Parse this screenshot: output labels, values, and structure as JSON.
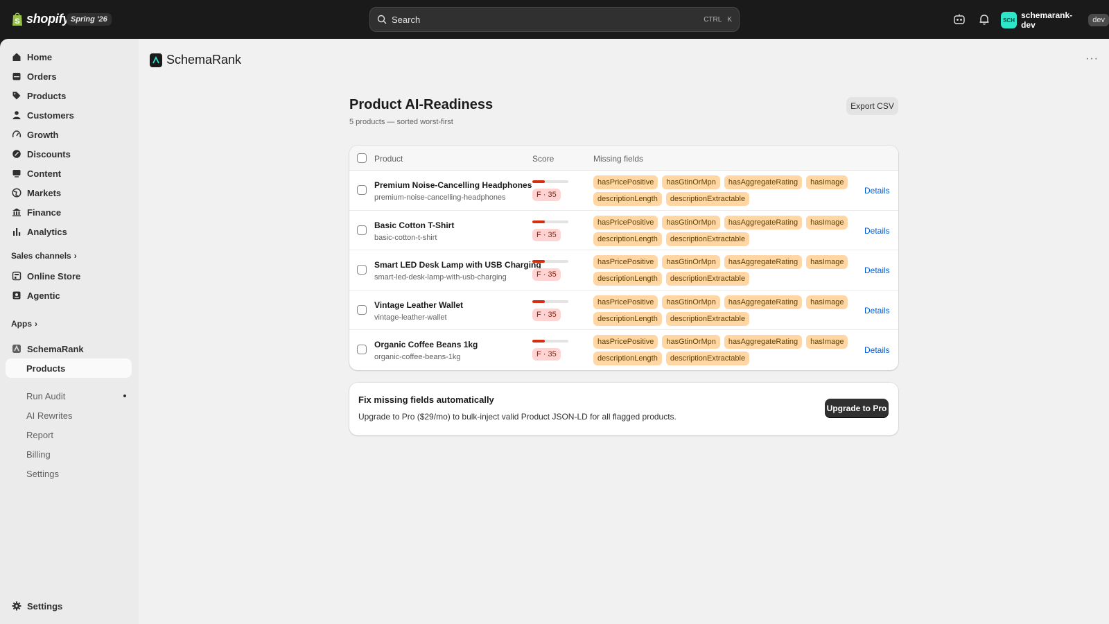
{
  "topbar": {
    "brand": "shopify",
    "edition": "Spring '26",
    "search_placeholder": "Search",
    "shortcut_ctrl": "CTRL",
    "shortcut_key": "K",
    "user_initials": "SCH",
    "user_name": "schemarank-dev",
    "user_badge": "dev"
  },
  "sidebar": {
    "items": [
      {
        "label": "Home",
        "icon": "home-icon"
      },
      {
        "label": "Orders",
        "icon": "inbox-icon"
      },
      {
        "label": "Products",
        "icon": "tag-icon"
      },
      {
        "label": "Customers",
        "icon": "person-icon"
      },
      {
        "label": "Growth",
        "icon": "gauge-icon"
      },
      {
        "label": "Discounts",
        "icon": "discount-icon"
      },
      {
        "label": "Content",
        "icon": "content-icon"
      },
      {
        "label": "Markets",
        "icon": "globe-icon"
      },
      {
        "label": "Finance",
        "icon": "bank-icon"
      },
      {
        "label": "Analytics",
        "icon": "chart-icon"
      }
    ],
    "sales_channels_label": "Sales channels",
    "channels": [
      {
        "label": "Online Store",
        "icon": "store-icon"
      },
      {
        "label": "Agentic",
        "icon": "agent-icon"
      }
    ],
    "apps_label": "Apps",
    "app_name": "SchemaRank",
    "app_subitems": [
      "Products",
      "Run Audit",
      "AI Rewrites",
      "Report",
      "Billing",
      "Settings"
    ],
    "settings_label": "Settings"
  },
  "main": {
    "app_title": "SchemaRank",
    "more_label": "···",
    "page_title": "Product AI-Readiness",
    "page_subtitle": "5 products — sorted worst-first",
    "export_label": "Export CSV",
    "columns": {
      "product": "Product",
      "score": "Score",
      "missing": "Missing fields"
    },
    "rows": [
      {
        "name": "Premium Noise-Cancelling Headphones",
        "handle": "premium-noise-cancelling-headphones",
        "score": 35,
        "grade": "F · 35",
        "missing": [
          "hasPricePositive",
          "hasGtinOrMpn",
          "hasAggregateRating",
          "hasImage",
          "descriptionLength",
          "descriptionExtractable"
        ],
        "action": "Details"
      },
      {
        "name": "Basic Cotton T-Shirt",
        "handle": "basic-cotton-t-shirt",
        "score": 35,
        "grade": "F · 35",
        "missing": [
          "hasPricePositive",
          "hasGtinOrMpn",
          "hasAggregateRating",
          "hasImage",
          "descriptionLength",
          "descriptionExtractable"
        ],
        "action": "Details"
      },
      {
        "name": "Smart LED Desk Lamp with USB Charging",
        "handle": "smart-led-desk-lamp-with-usb-charging",
        "score": 35,
        "grade": "F · 35",
        "missing": [
          "hasPricePositive",
          "hasGtinOrMpn",
          "hasAggregateRating",
          "hasImage",
          "descriptionLength",
          "descriptionExtractable"
        ],
        "action": "Details"
      },
      {
        "name": "Vintage Leather Wallet",
        "handle": "vintage-leather-wallet",
        "score": 35,
        "grade": "F · 35",
        "missing": [
          "hasPricePositive",
          "hasGtinOrMpn",
          "hasAggregateRating",
          "hasImage",
          "descriptionLength",
          "descriptionExtractable"
        ],
        "action": "Details"
      },
      {
        "name": "Organic Coffee Beans 1kg",
        "handle": "organic-coffee-beans-1kg",
        "score": 35,
        "grade": "F · 35",
        "missing": [
          "hasPricePositive",
          "hasGtinOrMpn",
          "hasAggregateRating",
          "hasImage",
          "descriptionLength",
          "descriptionExtractable"
        ],
        "action": "Details"
      }
    ],
    "promo": {
      "title": "Fix missing fields automatically",
      "body": "Upgrade to Pro ($29/mo) to bulk-inject valid Product JSON-LD for all flagged products.",
      "button": "Upgrade to Pro"
    }
  },
  "colors": {
    "topbar_bg": "#1a1a1a",
    "sidebar_bg": "#ebebeb",
    "main_bg": "#f1f1f1",
    "score_bar": "#d72c0d",
    "grade_bg": "#fed3d1",
    "tag_bg": "#ffd6a4",
    "link": "#005bd3",
    "avatar": "#2ee6c8"
  }
}
